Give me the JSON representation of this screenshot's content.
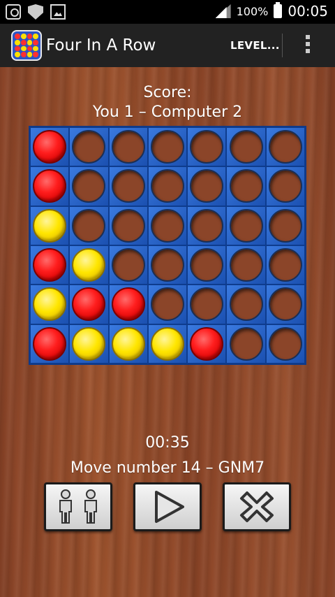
{
  "status_bar": {
    "battery": "100%",
    "time": "00:05"
  },
  "app_bar": {
    "title": "Four In A Row",
    "level_button": "LEVEL..."
  },
  "score": {
    "label": "Score:",
    "line": "You 1 – Computer 2"
  },
  "board": {
    "columns": 7,
    "rows": 6,
    "cells": [
      [
        "red",
        "empty",
        "empty",
        "empty",
        "empty",
        "empty",
        "empty"
      ],
      [
        "red",
        "empty",
        "empty",
        "empty",
        "empty",
        "empty",
        "empty"
      ],
      [
        "yellow",
        "empty",
        "empty",
        "empty",
        "empty",
        "empty",
        "empty"
      ],
      [
        "red",
        "yellow",
        "empty",
        "empty",
        "empty",
        "empty",
        "empty"
      ],
      [
        "yellow",
        "red",
        "red",
        "empty",
        "empty",
        "empty",
        "empty"
      ],
      [
        "red",
        "yellow",
        "yellow",
        "yellow",
        "red",
        "empty",
        "empty"
      ]
    ]
  },
  "game": {
    "timer": "00:35",
    "move_line": "Move number 14 – GNM7"
  },
  "colors": {
    "board_blue": "#1e5ac2",
    "red_disc": "#ff1e1e",
    "yellow_disc": "#ffe600",
    "wood": "#8e4729"
  },
  "controls": {
    "players_icon": "two-players-icon",
    "play_icon": "play-icon",
    "close_icon": "close-icon"
  }
}
